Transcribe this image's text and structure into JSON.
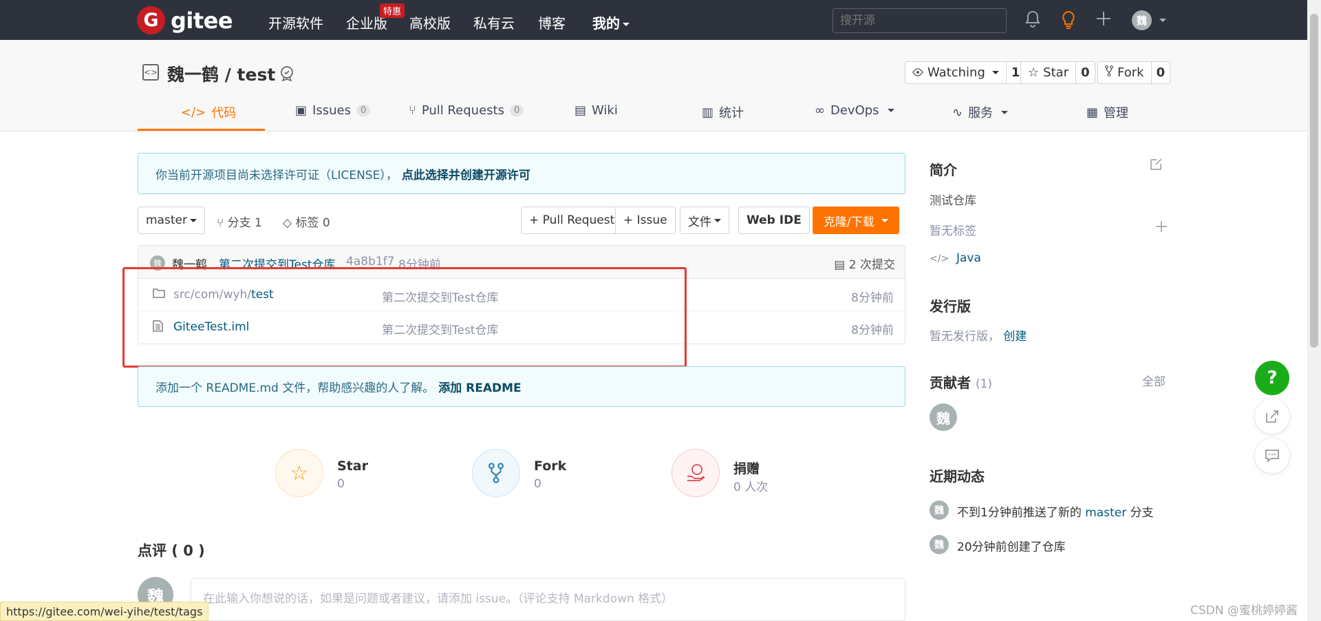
{
  "nav": {
    "brand": "gitee",
    "brand_mark": "G",
    "items": [
      "开源软件",
      "企业版",
      "高校版",
      "私有云",
      "博客",
      "我的"
    ],
    "special_badge": "特惠",
    "search_placeholder": "搜开源",
    "user_initial": "魏"
  },
  "repo": {
    "title": "魏一鹤 / test",
    "watch_label": "Watching",
    "watch_count": "1",
    "star_label": "Star",
    "star_count": "0",
    "fork_label": "Fork",
    "fork_count": "0"
  },
  "tabs": [
    {
      "label": "代码"
    },
    {
      "label": "Issues",
      "count": "0"
    },
    {
      "label": "Pull Requests",
      "count": "0"
    },
    {
      "label": "Wiki"
    },
    {
      "label": "统计"
    },
    {
      "label": "DevOps"
    },
    {
      "label": "服务"
    },
    {
      "label": "管理"
    }
  ],
  "license_notice": {
    "text": "你当前开源项目尚未选择许可证（LICENSE），",
    "link": "点此选择并创建开源许可"
  },
  "toolbar": {
    "branch": "master",
    "branches": "分支 1",
    "tags": "标签 0",
    "pull_request": "+ Pull Request",
    "issue": "+ Issue",
    "file": "文件",
    "web_ide": "Web IDE",
    "clone": "克隆/下载"
  },
  "commit": {
    "author_initial": "魏",
    "author": "魏一鹤",
    "message": "第二次提交到Test仓库",
    "hash": "4a8b1f7",
    "time": "8分钟前",
    "count": "2 次提交"
  },
  "files": [
    {
      "path_prefix": "src/com/wyh/",
      "name": "test",
      "message": "第二次提交到Test仓库",
      "time": "8分钟前",
      "type": "folder"
    },
    {
      "path_prefix": "",
      "name": "GiteeTest.iml",
      "message": "第二次提交到Test仓库",
      "time": "8分钟前",
      "type": "file"
    }
  ],
  "readme_notice": {
    "text": "添加一个 README.md 文件，帮助感兴趣的人了解。",
    "link": "添加 README"
  },
  "stats": [
    {
      "label": "Star",
      "value": "0"
    },
    {
      "label": "Fork",
      "value": "0"
    },
    {
      "label": "捐赠",
      "value": "0 人次"
    }
  ],
  "comments": {
    "title": "点评 ( 0 )",
    "avatar_initial": "魏",
    "placeholder": "在此输入你想说的话，如果是问题或者建议，请添加 issue。（评论支持 Markdown 格式）"
  },
  "sidebar": {
    "intro_title": "简介",
    "intro_text": "测试仓库",
    "no_tags": "暂无标签",
    "language": "Java",
    "release_title": "发行版",
    "release_text": "暂无发行版，",
    "release_link": "创建",
    "contrib_title": "贡献者",
    "contrib_count": "(1)",
    "contrib_all": "全部",
    "contrib_initial": "魏",
    "activity_title": "近期动态",
    "activity": [
      {
        "initial": "魏",
        "pre": "不到1分钟前推送了新的 ",
        "link": "master",
        "post": " 分支"
      },
      {
        "initial": "魏",
        "pre": "20分钟前创建了仓库",
        "link": "",
        "post": ""
      }
    ]
  },
  "status_url": "https://gitee.com/wei-yihe/test/tags",
  "watermark": "CSDN @蜜桃婷婷酱",
  "colors": {
    "accent": "#fe7300",
    "nav_bg": "#2e323c",
    "link": "#005980",
    "highlight_box": "#e53935",
    "help": "#1aad19"
  }
}
